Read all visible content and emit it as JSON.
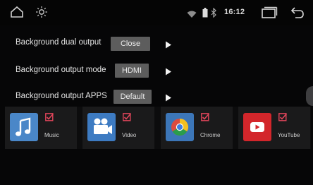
{
  "status_bar": {
    "time": "16:12",
    "icons": [
      "home-icon",
      "brightness-icon",
      "wifi-icon",
      "battery-icon",
      "bluetooth-icon",
      "recent-apps-icon",
      "back-icon"
    ]
  },
  "settings": [
    {
      "label": "Background dual output",
      "value": "Close"
    },
    {
      "label": "Background output mode",
      "value": "HDMI"
    },
    {
      "label": "Background output APPS",
      "value": "Default"
    }
  ],
  "apps": [
    {
      "label": "Music",
      "icon": "music-note-icon",
      "color": "#4a87c8",
      "checked": true
    },
    {
      "label": "Video",
      "icon": "video-camera-icon",
      "color": "#3d7bc2",
      "checked": true
    },
    {
      "label": "Chrome",
      "icon": "chrome-icon",
      "color": "#3c76b8",
      "checked": true
    },
    {
      "label": "YouTube",
      "icon": "youtube-icon",
      "color": "#d3262b",
      "checked": true
    }
  ],
  "colors": {
    "background": "#060607",
    "value_box": "#5d5d5d",
    "tile": "#1a1a1b",
    "checkbox_accent": "#e0455a"
  }
}
